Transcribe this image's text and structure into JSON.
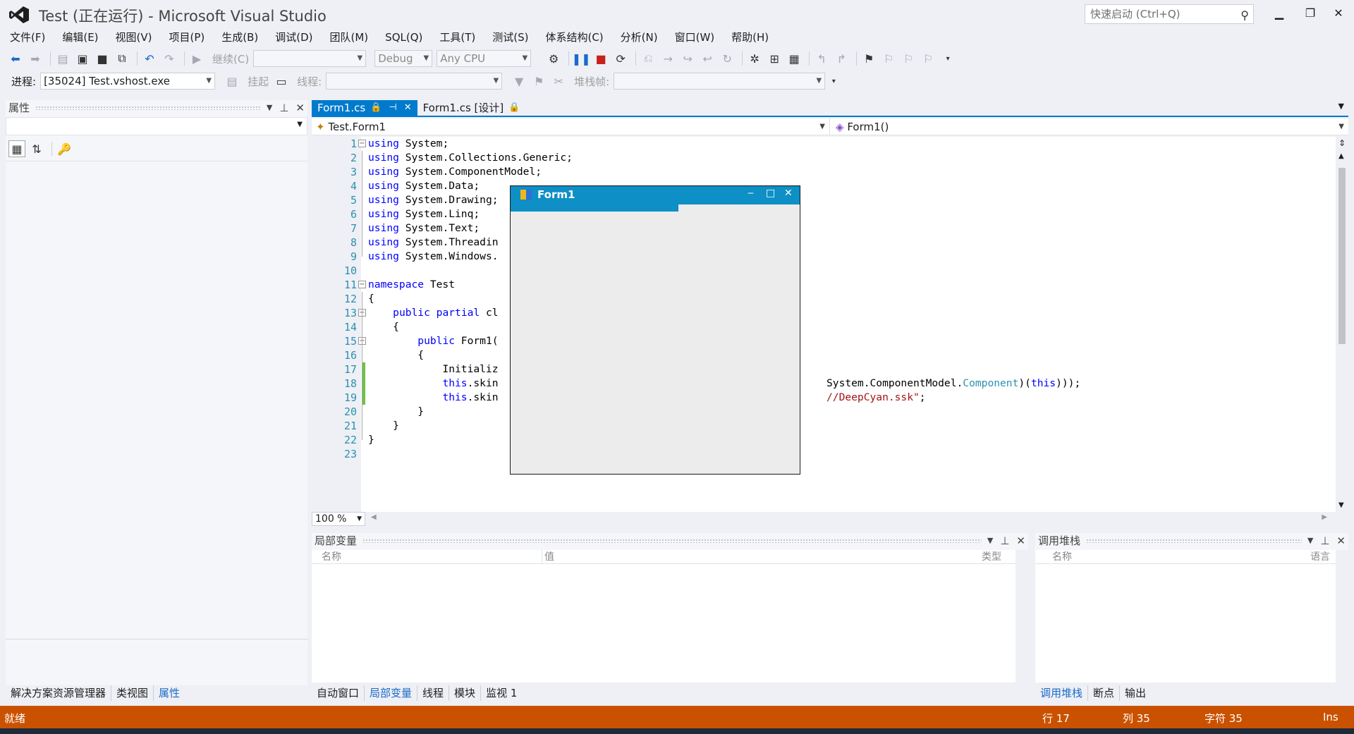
{
  "window": {
    "title": "Test (正在运行) - Microsoft Visual Studio",
    "quick_launch_placeholder": "快速启动 (Ctrl+Q)"
  },
  "menu": [
    "文件(F)",
    "编辑(E)",
    "视图(V)",
    "项目(P)",
    "生成(B)",
    "调试(D)",
    "团队(M)",
    "SQL(Q)",
    "工具(T)",
    "测试(S)",
    "体系结构(C)",
    "分析(N)",
    "窗口(W)",
    "帮助(H)"
  ],
  "toolbar1": {
    "continue_label": "继续(C)",
    "config": "Debug",
    "platform": "Any CPU"
  },
  "toolbar2": {
    "process_label": "进程:",
    "process_value": "[35024] Test.vshost.exe",
    "suspend_label": "挂起",
    "thread_label": "线程:",
    "stackframe_label": "堆栈帧:"
  },
  "properties_panel": {
    "title": "属性"
  },
  "left_bottom_tabs": [
    "解决方案资源管理器",
    "类视图",
    "属性"
  ],
  "doc_tabs": [
    {
      "label": "Form1.cs",
      "active": true
    },
    {
      "label": "Form1.cs [设计]",
      "active": false
    }
  ],
  "navbar": {
    "class_combo": "Test.Form1",
    "member_combo": "Form1()"
  },
  "editor": {
    "line_numbers": [
      "1",
      "2",
      "3",
      "4",
      "5",
      "6",
      "7",
      "8",
      "9",
      "10",
      "11",
      "12",
      "13",
      "14",
      "15",
      "16",
      "17",
      "18",
      "19",
      "20",
      "21",
      "22",
      "23"
    ],
    "lines": [
      "using System;",
      "using System.Collections.Generic;",
      "using System.ComponentModel;",
      "using System.Data;",
      "using System.Drawing;",
      "using System.Linq;",
      "using System.Text;",
      "using System.Threadin",
      "using System.Windows.",
      "",
      "namespace Test",
      "{",
      "    public partial cl",
      "    {",
      "        public Form1(",
      "        {",
      "            Initializ",
      "            this.skin",
      "            this.skin",
      "        }",
      "    }",
      "}",
      ""
    ],
    "line18_tail_a": "System.ComponentModel.",
    "line18_tail_b": "Component",
    "line18_tail_c": ")(",
    "line18_tail_d": "this",
    "line18_tail_e": ")));",
    "line19_tail_a": "//DeepCyan.ssk\"",
    "line19_tail_b": ";",
    "zoom": "100 %"
  },
  "form1": {
    "title": "Form1",
    "min": "‒",
    "max": "□",
    "close": "✕"
  },
  "locals_panel": {
    "title": "局部变量",
    "columns": [
      "名称",
      "值",
      "类型"
    ]
  },
  "callstack_panel": {
    "title": "调用堆栈",
    "columns": [
      "名称",
      "语言"
    ]
  },
  "locals_tabs": [
    "自动窗口",
    "局部变量",
    "线程",
    "模块",
    "监视 1"
  ],
  "callstack_tabs": [
    "调用堆栈",
    "断点",
    "输出"
  ],
  "status": {
    "ready": "就绪",
    "row": "行 17",
    "col": "列 35",
    "char": "字符 35",
    "ins": "Ins"
  },
  "colors": {
    "accent": "#007acc",
    "status_bar": "#ca5100",
    "form_title": "#0e8fc6"
  }
}
